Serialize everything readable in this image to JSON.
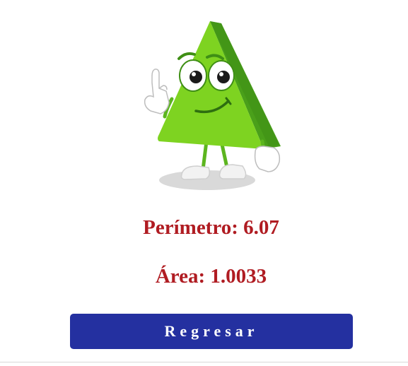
{
  "mascot": {
    "icon": "triangle-mascot-icon",
    "body_color": "#7ed321",
    "shade_color": "#4aa01a"
  },
  "results": {
    "perimeter_label": "Perímetro:",
    "perimeter_value": "6.07",
    "area_label": "Área:",
    "area_value": "1.0033",
    "color": "#b01c22"
  },
  "actions": {
    "back_label": "Regresar",
    "button_color": "#2430a0"
  }
}
